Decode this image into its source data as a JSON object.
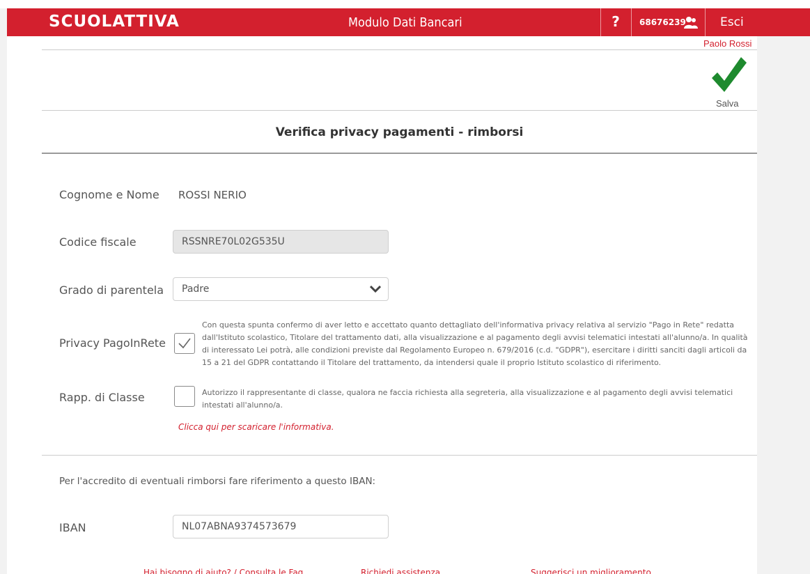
{
  "header": {
    "logo": "SCUOLATTIVA",
    "title": "Modulo Dati Bancari",
    "help": "?",
    "user_code": "68676239",
    "logout": "Esci"
  },
  "user": {
    "name": "Paolo Rossi"
  },
  "toolbar": {
    "save_label": "Salva"
  },
  "section": {
    "title": "Verifica privacy pagamenti - rimborsi"
  },
  "form": {
    "name_label": "Cognome e Nome",
    "name_value": "ROSSI NERIO",
    "cf_label": "Codice fiscale",
    "cf_value": "RSSNRE70L02G535U",
    "grado_label": "Grado di parentela",
    "grado_value": "Padre",
    "privacy_label": "Privacy PagoInRete",
    "privacy_checked": true,
    "privacy_text": "Con questa spunta confermo di aver letto e accettato quanto dettagliato dell'informativa privacy relativa al servizio \"Pago in Rete\" redatta dall'Istituto scolastico, Titolare del trattamento dati, alla visualizzazione e al pagamento degli avvisi telematici intestati all'alunno/a. In qualità di interessato Lei potrà, alle condizioni previste dal Regolamento Europeo n. 679/2016 (c.d. \"GDPR\"), esercitare i diritti sanciti dagli articoli da 15 a 21 del GDPR contattando il Titolare del trattamento, da intendersi quale il proprio Istituto scolastico di riferimento.",
    "rapp_label": "Rapp. di Classe",
    "rapp_checked": false,
    "rapp_text": "Autorizzo il rappresentante di classe, qualora ne faccia richiesta alla segreteria, alla visualizzazione e al pagamento degli avvisi telematici intestati all'alunno/a.",
    "download_link": "Clicca qui per scaricare l'informativa."
  },
  "iban": {
    "intro": "Per l'accredito di eventuali rimborsi fare riferimento a questo IBAN:",
    "label": "IBAN",
    "value": "NL07ABNA9374573679"
  },
  "footer": {
    "help": "Hai bisogno di aiuto? / Consulta le Faq",
    "assist": "Richiedi assistenza",
    "suggest": "Suggerisci un miglioramento"
  },
  "colors": {
    "brand_red": "#d3202e",
    "check_green": "#1e8a2e"
  }
}
